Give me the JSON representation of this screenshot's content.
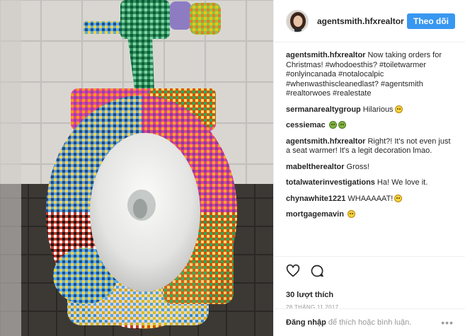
{
  "post": {
    "username": "agentsmith.hfxrealtor",
    "follow_label": "Theo dõi"
  },
  "comments": [
    {
      "user": "agentsmith.hfxrealtor",
      "text": "Now taking orders for Christmas! #whodoesthis? #toiletwarmer #onlyincanada #notalocalpic #whenwasthiscleanedlast? #agentsmith #realtorwoes #realestate",
      "emoji": []
    },
    {
      "user": "sermanarealtygroup",
      "text": "Hilarious",
      "emoji": [
        "yellow"
      ]
    },
    {
      "user": "cessiemac",
      "text": "",
      "emoji": [
        "green",
        "green"
      ]
    },
    {
      "user": "agentsmith.hfxrealtor",
      "text": "Right?! It's not even just a seat warmer! It's a legit decoration lmao.",
      "emoji": []
    },
    {
      "user": "mabeltherealtor",
      "text": "Gross!",
      "emoji": []
    },
    {
      "user": "totalwaterinvestigations",
      "text": "Ha! We love it.",
      "emoji": []
    },
    {
      "user": "chynawhite1221",
      "text": "WHAAAAAT!",
      "emoji": [
        "yellow"
      ]
    },
    {
      "user": "mortgagemavin",
      "text": "",
      "emoji": [
        "yellow"
      ]
    }
  ],
  "actions": {
    "like_icon": "heart-outline-icon",
    "comment_icon": "speech-bubble-icon",
    "likes": "30 lượt thích",
    "date": "28 THÁNG 11 2017"
  },
  "footer": {
    "login_link": "Đăng nhập",
    "login_rest": "để thích hoặc bình luận.",
    "more": "•••"
  }
}
